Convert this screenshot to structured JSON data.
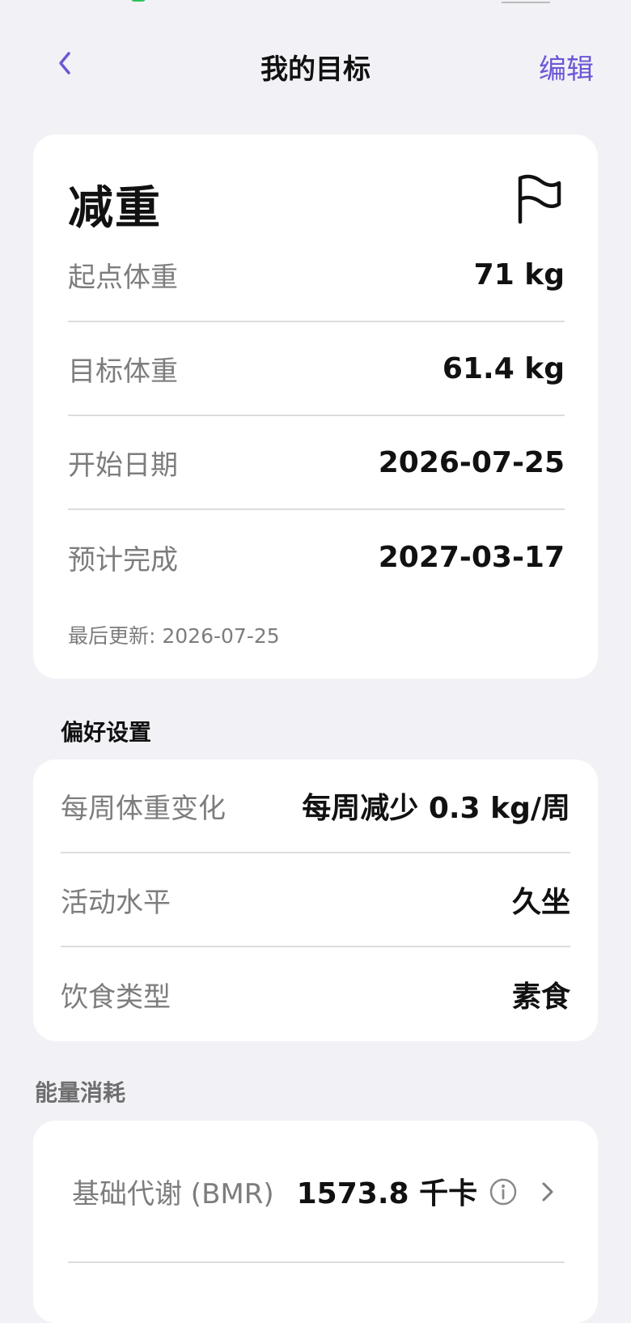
{
  "header": {
    "title": "我的目标",
    "edit_label": "编辑"
  },
  "goal": {
    "title": "减重",
    "rows": [
      {
        "label": "起点体重",
        "value": "71 kg"
      },
      {
        "label": "目标体重",
        "value": "61.4 kg"
      },
      {
        "label": "开始日期",
        "value": "2026-07-25"
      },
      {
        "label": "预计完成",
        "value": "2027-03-17"
      }
    ],
    "last_updated": "最后更新: 2026-07-25"
  },
  "preferences": {
    "heading": "偏好设置",
    "rows": [
      {
        "label": "每周体重变化",
        "value": "每周减少 0.3 kg/周"
      },
      {
        "label": "活动水平",
        "value": "久坐"
      },
      {
        "label": "饮食类型",
        "value": "素食"
      }
    ]
  },
  "energy": {
    "heading": "能量消耗",
    "bmr_label": "基础代谢 (BMR)",
    "bmr_value": "1573.8 千卡"
  },
  "icons": {
    "back": "chevron-left-icon",
    "flag": "flag-icon",
    "info": "info-icon",
    "chevron": "chevron-right-icon"
  },
  "colors": {
    "accent": "#6b57d6",
    "background": "#f2f1f6",
    "card": "#ffffff"
  }
}
